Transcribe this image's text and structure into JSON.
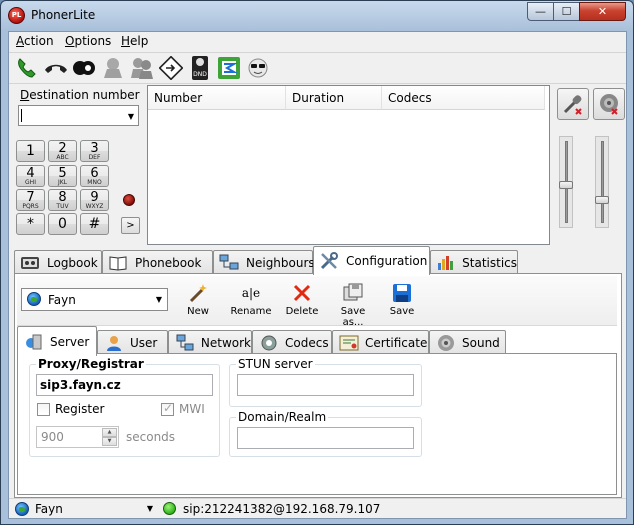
{
  "window": {
    "title": "PhonerLite",
    "app_icon_text": "PL"
  },
  "menu": {
    "items": [
      "Action",
      "Options",
      "Help"
    ]
  },
  "toolbar": {
    "icons": [
      "call-green-icon",
      "hangup-icon",
      "hold-icon",
      "user-gray-icon",
      "conference-icon",
      "transfer-icon",
      "dnd-icon",
      "redirect-icon",
      "smiley-sunglasses-icon"
    ],
    "dnd_text": "DND"
  },
  "dialer": {
    "destination_label": "Destination number",
    "destination_value": "",
    "keys": [
      {
        "digit": "1",
        "letters": ""
      },
      {
        "digit": "2",
        "letters": "ABC"
      },
      {
        "digit": "3",
        "letters": "DEF"
      },
      {
        "digit": "4",
        "letters": "GHI"
      },
      {
        "digit": "5",
        "letters": "JKL"
      },
      {
        "digit": "6",
        "letters": "MNO"
      },
      {
        "digit": "7",
        "letters": "PQRS"
      },
      {
        "digit": "8",
        "letters": "TUV"
      },
      {
        "digit": "9",
        "letters": "WXYZ"
      },
      {
        "digit": "*",
        "letters": ""
      },
      {
        "digit": "0",
        "letters": ""
      },
      {
        "digit": "#",
        "letters": ""
      }
    ],
    "expand_label": ">"
  },
  "calls": {
    "columns": [
      "Number",
      "Duration",
      "Codecs"
    ]
  },
  "audio": {
    "mic_muted": true,
    "speaker_muted": true,
    "mic_level": 0.2,
    "speaker_level": 0.2
  },
  "main_tabs": {
    "items": [
      "Logbook",
      "Phonebook",
      "Neighbours",
      "Configuration",
      "Statistics"
    ],
    "active": "Configuration"
  },
  "profile": {
    "selected": "Fayn",
    "actions": [
      "New",
      "Rename",
      "Delete",
      "Save as...",
      "Save"
    ],
    "rename_glyph": "a|e"
  },
  "config_tabs": {
    "items": [
      "Server",
      "User",
      "Network",
      "Codecs",
      "Certificate",
      "Sound"
    ],
    "active": "Server"
  },
  "server": {
    "proxy_label": "Proxy/Registrar",
    "proxy_value": "sip3.fayn.cz",
    "register_label": "Register",
    "register_checked": false,
    "mwi_label": "MWI",
    "mwi_checked": true,
    "expiry_value": "900",
    "expiry_unit": "seconds",
    "stun_label": "STUN server",
    "stun_value": "",
    "domain_label": "Domain/Realm",
    "domain_value": ""
  },
  "status": {
    "profile": "Fayn",
    "uri": "sip:212241382@192.168.79.107",
    "registered_color": "#2fb318"
  },
  "colors": {
    "close_button": "#c94330",
    "delete_x": "#e02a12",
    "save_blue": "#1c6fd6",
    "titlebar": "#a9c0da"
  }
}
